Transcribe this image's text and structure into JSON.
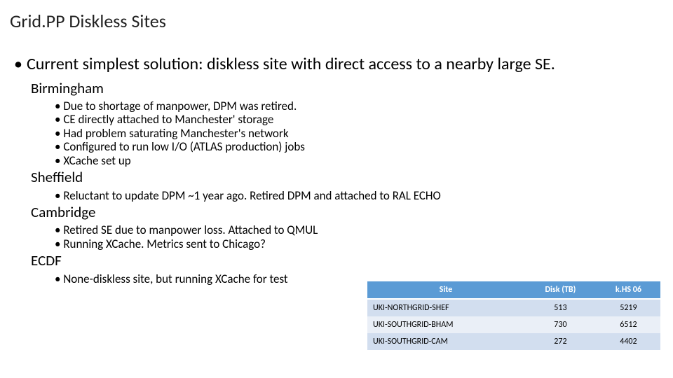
{
  "title": "Grid.PP Diskless Sites",
  "main_bullet": "Current simplest solution: diskless site with direct access to a nearby large SE.",
  "sections": {
    "birmingham": {
      "heading": "Birmingham",
      "items": [
        "Due to shortage of manpower, DPM was retired.",
        "CE directly attached to Manchester' storage",
        "Had problem saturating Manchester's network",
        "Configured to run low I/O (ATLAS production) jobs",
        "XCache set up"
      ]
    },
    "sheffield": {
      "heading": "Sheffield",
      "items": [
        "Reluctant to update DPM ~1 year ago. Retired DPM and attached to RAL ECHO"
      ]
    },
    "cambridge": {
      "heading": "Cambridge",
      "items": [
        "Retired SE due to manpower loss. Attached to QMUL",
        "Running XCache. Metrics sent to Chicago?"
      ]
    },
    "ecdf": {
      "heading": "ECDF",
      "items": [
        "None-diskless site, but running XCache for test"
      ]
    }
  },
  "table": {
    "headers": [
      "Site",
      "Disk (TB)",
      "k.HS 06"
    ],
    "rows": [
      {
        "site": "UKI-NORTHGRID-SHEF",
        "disk": "513",
        "hs": "5219"
      },
      {
        "site": "UKI-SOUTHGRID-BHAM",
        "disk": "730",
        "hs": "6512"
      },
      {
        "site": "UKI-SOUTHGRID-CAM",
        "disk": "272",
        "hs": "4402"
      }
    ]
  }
}
